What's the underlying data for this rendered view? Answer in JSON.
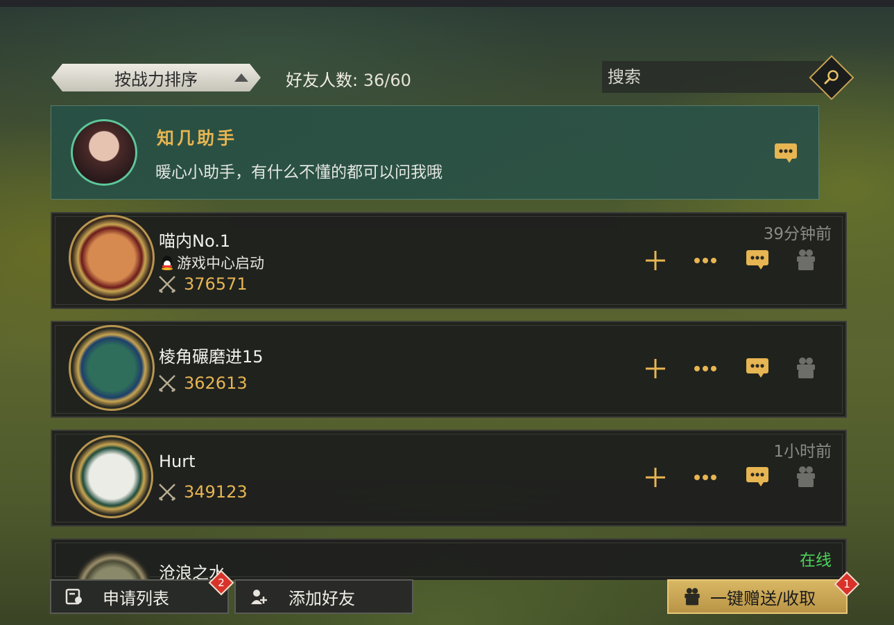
{
  "header": {
    "sort_label": "按战力排序",
    "friend_count_label": "好友人数:",
    "friend_count_value": "36/60",
    "search_placeholder": "搜索"
  },
  "assistant": {
    "name": "知几助手",
    "description": "暖心小助手，有什么不懂的都可以问我哦"
  },
  "friends": [
    {
      "name": "喵内No.1",
      "status": "游戏中心启动",
      "power": "376571",
      "time": "39分钟前"
    },
    {
      "name": "棱角碾磨进15",
      "power": "362613"
    },
    {
      "name": "Hurt",
      "power": "349123",
      "time": "1小时前"
    },
    {
      "name": "沧浪之水",
      "online": "在线"
    }
  ],
  "footer": {
    "requests_label": "申请列表",
    "requests_badge": "2",
    "add_friend_label": "添加好友",
    "gift_all_label": "一键赠送/收取",
    "gift_badge": "1"
  },
  "colors": {
    "gold": "#e7b552",
    "online": "#4ed35a",
    "assistant_bg": "#2c5246",
    "badge": "#d8332a"
  },
  "icons": [
    "search-icon",
    "chat-icon",
    "add-icon",
    "more-icon",
    "gift-icon",
    "power-icon",
    "qq-icon",
    "requests-icon",
    "add-friend-icon"
  ]
}
